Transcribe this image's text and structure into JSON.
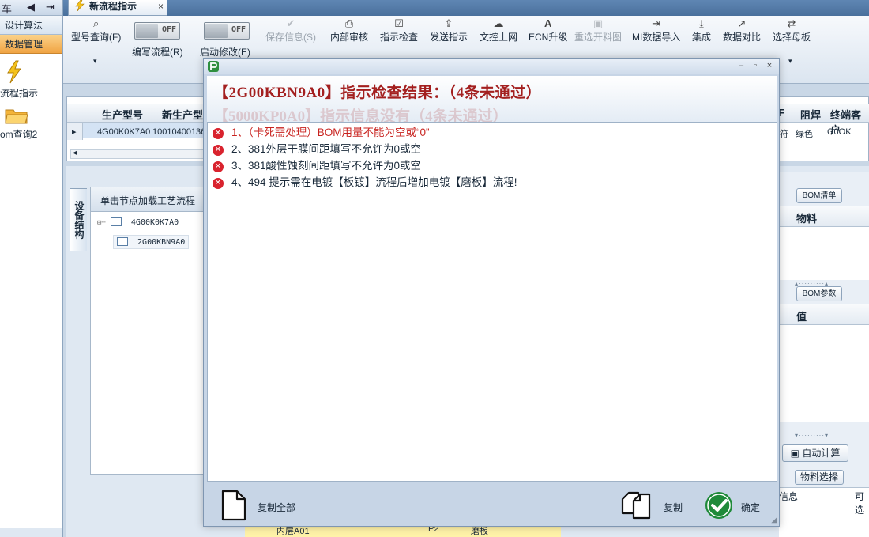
{
  "left_nav": {
    "top_icons": [
      "车",
      "◀",
      "⇥"
    ],
    "sections": [
      {
        "label": "设计算法",
        "selected": false
      },
      {
        "label": "数据管理",
        "selected": true
      }
    ],
    "items": [
      {
        "label": "流程指示",
        "icon": "lightning-icon"
      },
      {
        "label": "om查询2",
        "icon": "folder-icon"
      }
    ]
  },
  "tab": {
    "label": "新流程指示",
    "close": "×",
    "icon": "lightning-icon"
  },
  "ribbon": {
    "buttons": [
      {
        "label": "型号查询(F)",
        "icon": "search-icon",
        "enabled": true
      },
      {
        "label": "保存信息(S)",
        "icon": "check-icon",
        "enabled": false
      },
      {
        "label": "内部审核",
        "icon": "printer-icon",
        "enabled": true
      },
      {
        "label": "指示检查",
        "icon": "checkbox-icon",
        "enabled": true
      },
      {
        "label": "发送指示",
        "icon": "upload-icon",
        "enabled": true
      },
      {
        "label": "文控上网",
        "icon": "cloud-upload-icon",
        "enabled": true
      },
      {
        "label": "ECN升级",
        "icon": "font-icon",
        "enabled": true
      },
      {
        "label": "重选开料图",
        "icon": "image-icon",
        "enabled": false
      },
      {
        "label": "MI数据导入",
        "icon": "import-icon",
        "enabled": true
      },
      {
        "label": "集成",
        "icon": "download-icon",
        "enabled": true
      },
      {
        "label": "数据对比",
        "icon": "compress-icon",
        "enabled": true
      },
      {
        "label": "选择母板",
        "icon": "shuffle-icon",
        "enabled": true
      }
    ],
    "toggles": [
      {
        "label": "编写流程(R)",
        "state": "OFF"
      },
      {
        "label": "启动修改(E)",
        "state": "OFF"
      }
    ],
    "dropdown_arrow": "▾"
  },
  "grid": {
    "headers": [
      "生产型号",
      "新生产型",
      "阻焊",
      "终端客户"
    ],
    "right_fragment_header": "F",
    "row": {
      "marker": "▸",
      "model": "4G00K0K7A0",
      "new_model": "10010400136",
      "fragment": "符",
      "solder_mask": "绿色",
      "customer": "G0OK"
    },
    "scroll_left": "◂"
  },
  "lower": {
    "side_tab": "设备结构",
    "tree_header": "单击节点加载工艺流程",
    "tree_nodes": [
      {
        "label": "4G00K0K7A0"
      },
      {
        "label": "2G00KBN9A0"
      }
    ],
    "bottom_row": {
      "name": "内层A01",
      "code": "P2",
      "material": "磨板"
    }
  },
  "right_panel": {
    "bom_list_label": "BOM清单",
    "bom_list_col": "物料",
    "bom_param_label": "BOM参数",
    "bom_param_col": "值",
    "auto_calc_label": "自动计算",
    "material_select_label": "物料选择",
    "info_col": "信息",
    "avail_col": "可选"
  },
  "dialog": {
    "window_controls": [
      "–",
      "▫",
      "×"
    ],
    "title": "【2G00KBN9A0】指示检查结果：（4条未通过）",
    "ghost_subtitle": "【5000KP0A0】指示信息没有（4条未通过）",
    "issues": [
      {
        "text": "1、（卡死需处理）BOM用量不能为空或“0”",
        "blocking": true
      },
      {
        "text": "2、381外层干膜间距填写不允许为0或空",
        "blocking": false
      },
      {
        "text": "3、381酸性蚀刻间距填写不允许为0或空",
        "blocking": false
      },
      {
        "text": "4、494 提示需在电镀【板镀】流程后增加电镀【磨板】流程!",
        "blocking": false
      }
    ],
    "footer": {
      "copy_all_label": "复制全部",
      "copy_label": "复制",
      "confirm_label": "确定"
    },
    "error_icon_color": "#d9232e",
    "title_color": "#a31f1f",
    "confirm_icon_color": "#1f8a3a"
  }
}
